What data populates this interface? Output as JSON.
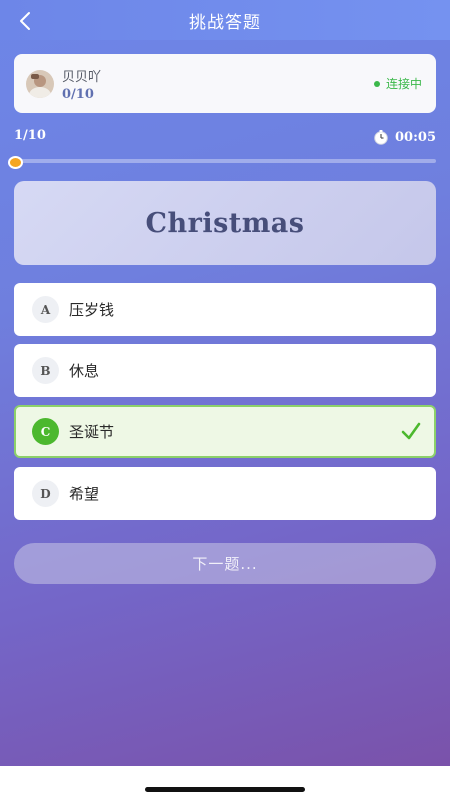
{
  "header": {
    "title": "挑战答题",
    "back_icon": "chevron-left-icon"
  },
  "user": {
    "name": "贝贝吖",
    "score": "0/10",
    "status": "连接中",
    "status_color": "#3bb84a"
  },
  "progress": {
    "count": "1/10",
    "fraction": 0.02,
    "timer": "00:05",
    "timer_icon": "stopwatch-icon"
  },
  "question": {
    "word": "Christmas"
  },
  "options": [
    {
      "letter": "A",
      "text": "压岁钱",
      "correct": false
    },
    {
      "letter": "B",
      "text": "休息",
      "correct": false
    },
    {
      "letter": "C",
      "text": "圣诞节",
      "correct": true
    },
    {
      "letter": "D",
      "text": "希望",
      "correct": false
    }
  ],
  "next_label": "下一题...",
  "colors": {
    "accent": "#6d86e8",
    "correct": "#4cb82e",
    "knob": "#f5a623"
  }
}
